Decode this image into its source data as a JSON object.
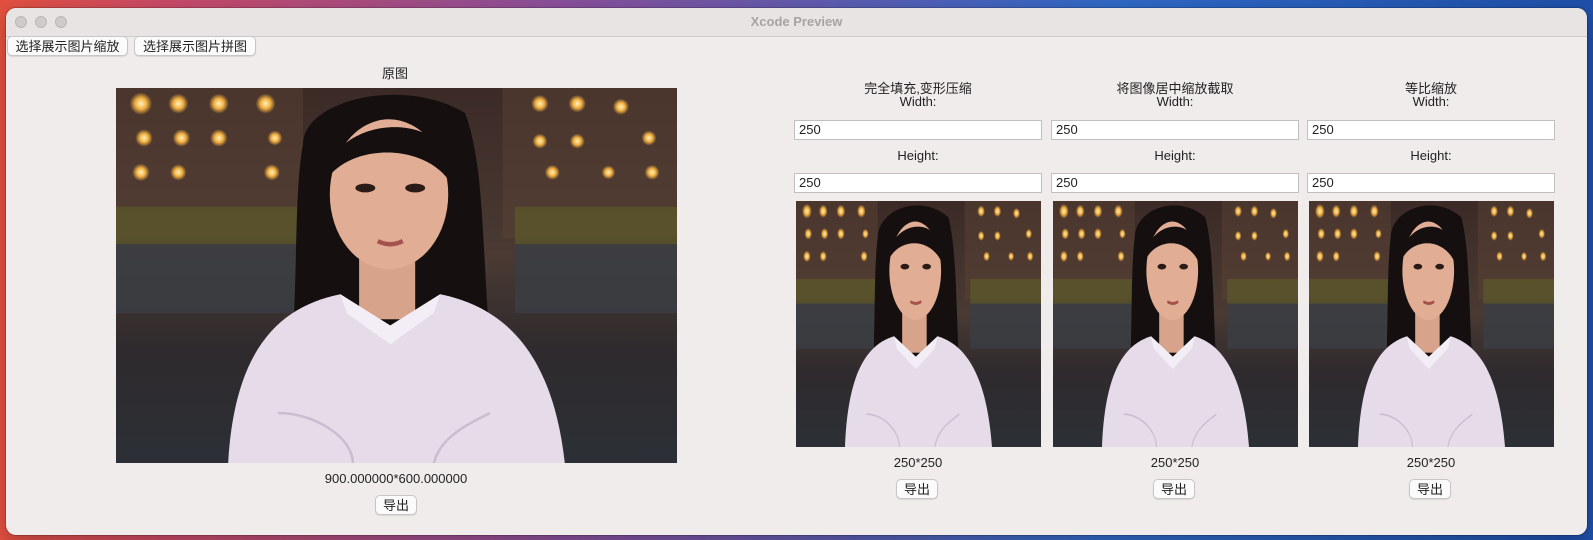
{
  "window": {
    "title": "Xcode Preview"
  },
  "toolbar": {
    "scale_button": "选择展示图片缩放",
    "collage_button": "选择展示图片拼图"
  },
  "original": {
    "label": "原图",
    "size_text": "900.000000*600.000000",
    "export_label": "导出"
  },
  "panels": [
    {
      "title": "完全填充,变形压缩",
      "width_label": "Width:",
      "width_value": "250",
      "height_label": "Height:",
      "height_value": "250",
      "size_text": "250*250",
      "export_label": "导出"
    },
    {
      "title": "将图像居中缩放截取",
      "width_label": "Width:",
      "width_value": "250",
      "height_label": "Height:",
      "height_value": "250",
      "size_text": "250*250",
      "export_label": "导出"
    },
    {
      "title": "等比缩放",
      "width_label": "Width:",
      "width_value": "250",
      "height_label": "Height:",
      "height_value": "250",
      "size_text": "250*250",
      "export_label": "导出"
    }
  ]
}
